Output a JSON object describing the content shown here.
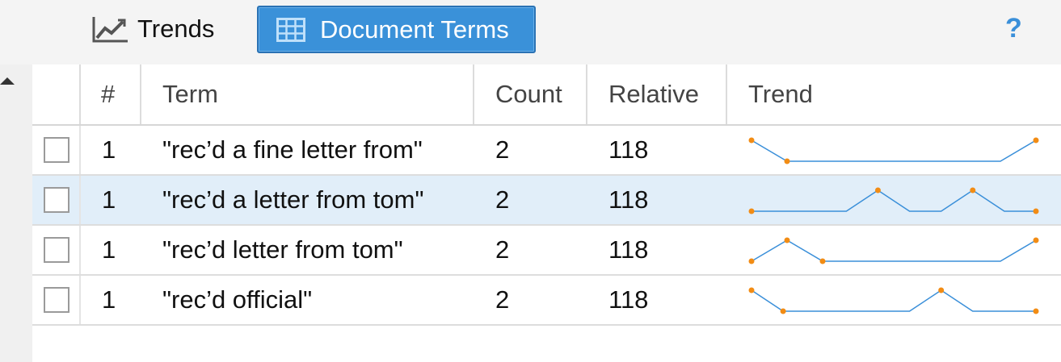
{
  "toolbar": {
    "trends_label": "Trends",
    "trends_icon": "line-chart-icon",
    "document_terms_label": "Document Terms",
    "document_terms_icon": "table-grid-icon",
    "help_label": "?",
    "active_tab": "Document Terms",
    "accent_color": "#3a91d9"
  },
  "grid": {
    "columns": [
      "#",
      "Term",
      "Count",
      "Relative",
      "Trend"
    ],
    "rows": [
      {
        "num": "1",
        "term": "\"rec’d a fine letter from\"",
        "count": "2",
        "relative": "118",
        "selected": false,
        "trend": [
          3,
          0,
          0,
          0,
          0,
          0,
          0,
          0,
          3
        ]
      },
      {
        "num": "1",
        "term": "\"rec’d a letter from tom\"",
        "count": "2",
        "relative": "118",
        "selected": true,
        "trend": [
          0,
          0,
          0,
          0,
          3,
          0,
          0,
          3,
          0,
          0
        ]
      },
      {
        "num": "1",
        "term": "\"rec’d letter from tom\"",
        "count": "2",
        "relative": "118",
        "selected": false,
        "trend": [
          0,
          3,
          0,
          0,
          0,
          0,
          0,
          0,
          3
        ]
      },
      {
        "num": "1",
        "term": "\"rec’d official\"",
        "count": "2",
        "relative": "118",
        "selected": false,
        "trend": [
          3,
          0,
          0,
          0,
          0,
          0,
          3,
          0,
          0,
          0
        ]
      }
    ],
    "sparkline_line_color": "#3a8fd9",
    "sparkline_point_color": "#f28c14"
  }
}
